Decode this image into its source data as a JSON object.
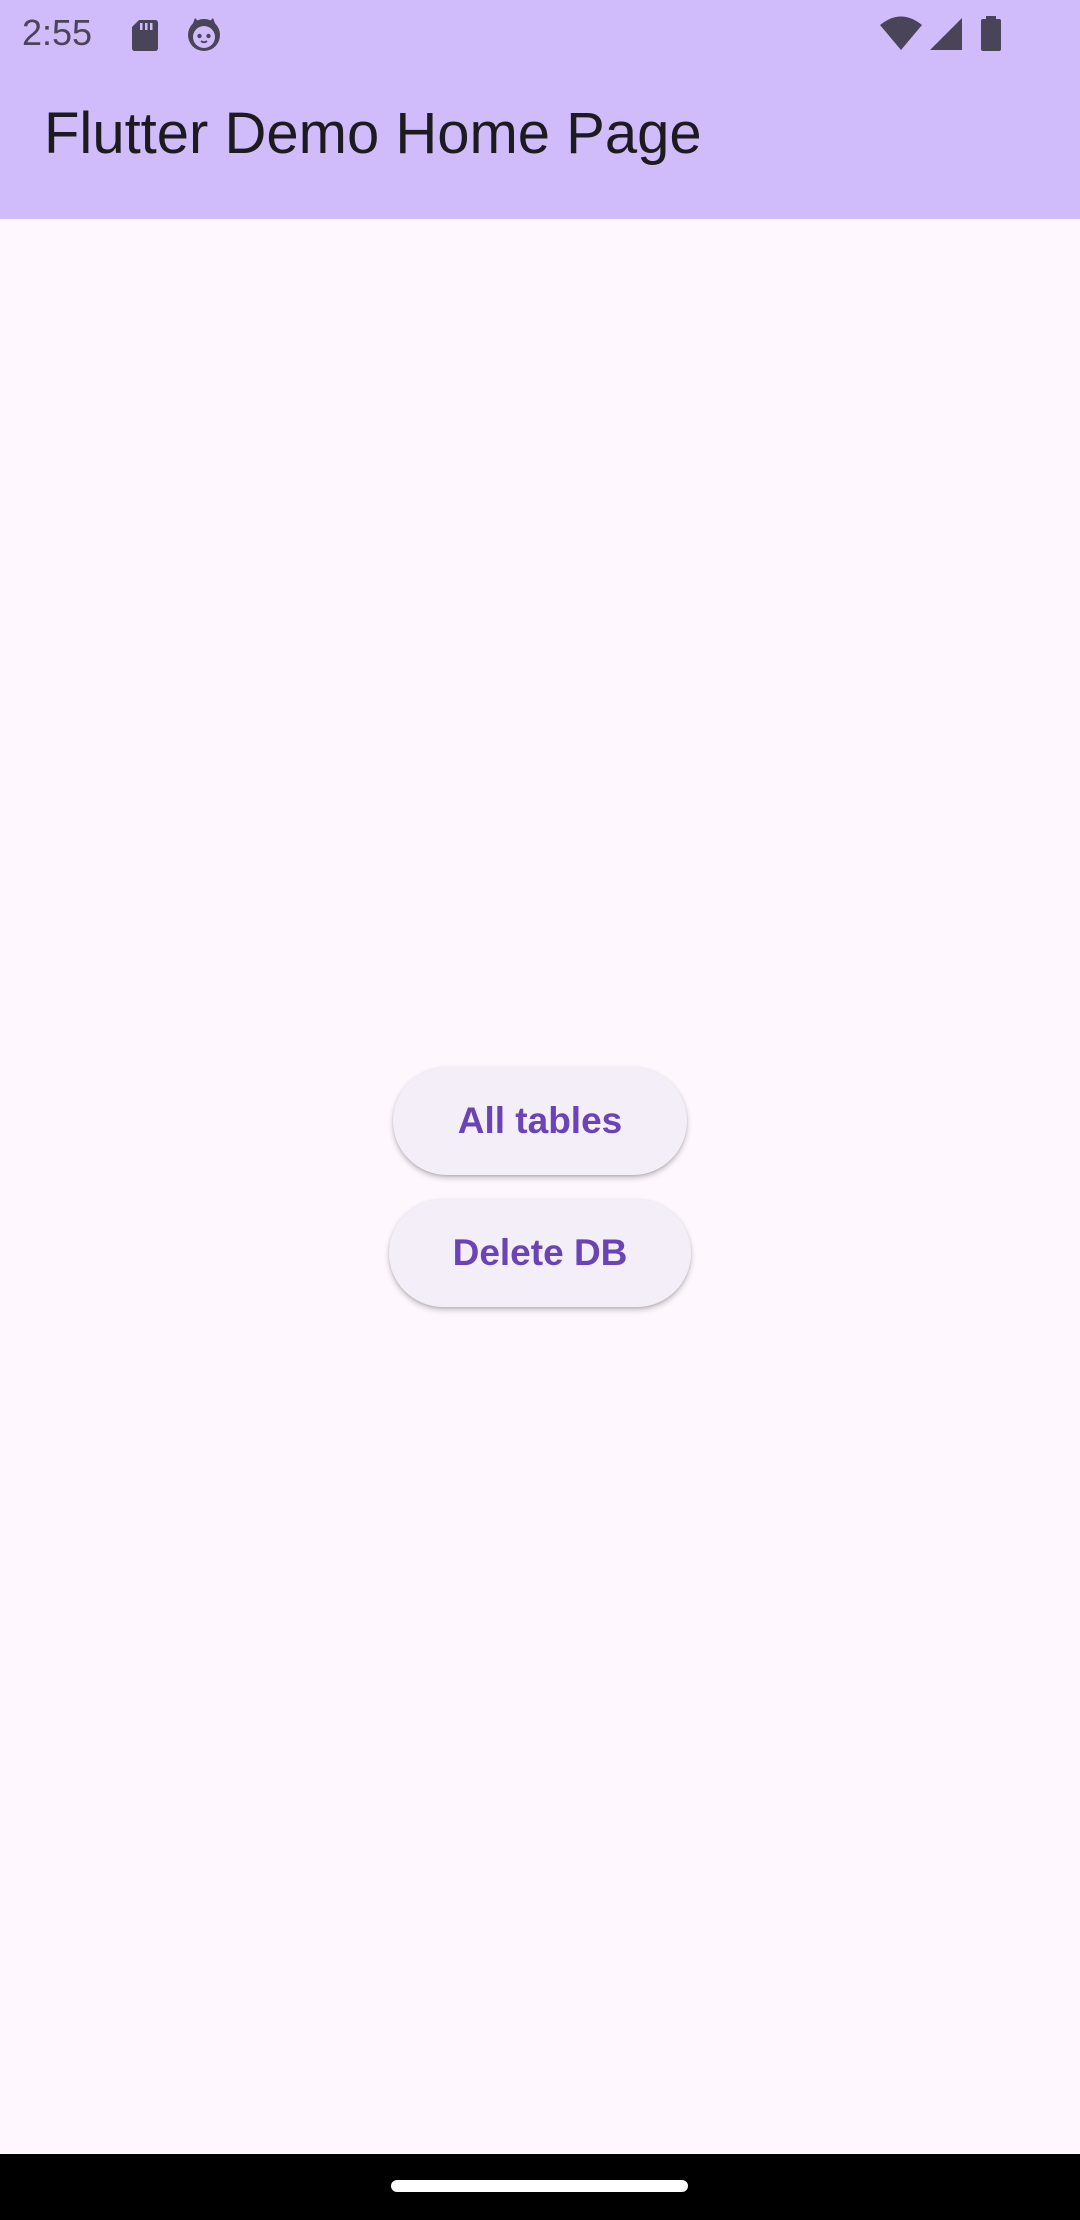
{
  "status_bar": {
    "time": "2:55",
    "icons": [
      "sd-card-icon",
      "cat-face-icon",
      "wifi-icon",
      "signal-icon",
      "battery-icon"
    ]
  },
  "app_bar": {
    "title": "Flutter Demo Home Page"
  },
  "main": {
    "buttons": [
      {
        "label": "All tables"
      },
      {
        "label": "Delete DB"
      }
    ]
  },
  "colors": {
    "app_bar_background": "#D1BCFB",
    "page_background": "#FFF7FE",
    "button_background": "#F4EEF8",
    "button_text": "#6A44B5",
    "title_text": "#1D1B20",
    "status_icons": "#4A4458",
    "nav_bar": "#000000"
  }
}
